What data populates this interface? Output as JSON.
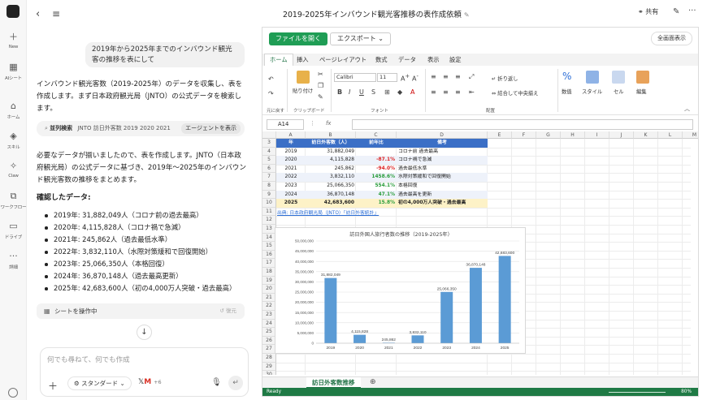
{
  "rail": {
    "items": [
      {
        "icon": "plus-icon",
        "label": "New"
      },
      {
        "icon": "grid-icon",
        "label": "AIシート"
      },
      {
        "icon": "home-icon",
        "label": "ホーム"
      },
      {
        "icon": "skill-icon",
        "label": "スキル"
      },
      {
        "icon": "claw-icon",
        "label": "Claw"
      },
      {
        "icon": "workflow-icon",
        "label": "ワークフロー"
      },
      {
        "icon": "folder-icon",
        "label": "ドライブ"
      },
      {
        "icon": "more-icon",
        "label": "詳細"
      }
    ]
  },
  "chat": {
    "user_message": "2019年から2025年までのインバウンド観光客の推移を表にして",
    "reply1": "インバウンド観光客数（2019-2025年）のデータを収集し、表を作成します。まず日本政府観光局（JNTO）の公式データを検索します。",
    "search": {
      "label": "並列検索",
      "query": "JNTO 訪日外客数 2019 2020 2021",
      "agent_button": "エージェントを表示"
    },
    "reply2": "必要なデータが揃いましたので、表を作成します。JNTO（日本政府観光局）の公式データに基づき、2019年〜2025年のインバウンド観光客数の推移をまとめます。",
    "confirmed_heading": "確認したデータ:",
    "bullets": [
      "2019年: 31,882,049人（コロナ前の過去最高）",
      "2020年: 4,115,828人（コロナ禍で急減）",
      "2021年: 245,862人（過去最低水準）",
      "2022年: 3,832,110人（水際対策緩和で回復開始）",
      "2023年: 25,066,350人（本格回復）",
      "2024年: 36,870,148人（過去最高更新）",
      "2025年: 42,683,600人（初の4,000万人突破・過去最高）"
    ],
    "operate_sheet": "シートを操作中",
    "restore": "復元",
    "input_placeholder": "何でも尋ねて、何でも作成",
    "mode": "スタンダード",
    "tools_more": "+6"
  },
  "topbar": {
    "title": "2019-2025年インバウンド観光客推移の表作成依頼",
    "share": "共有"
  },
  "excel": {
    "open_button": "ファイルを開く",
    "export_button": "エクスポート",
    "fullscreen_button": "全画面表示",
    "tabs": [
      "ホーム",
      "挿入",
      "ページレイアウト",
      "数式",
      "データ",
      "表示",
      "設定"
    ],
    "font_name": "Calibri",
    "font_size": "11",
    "group_labels": {
      "undo": "元に戻す",
      "clipboard": "クリップボード",
      "font": "フォント",
      "align": "配置"
    },
    "ribbon": {
      "paste": "貼り付け",
      "wrap": "折り返し",
      "merge": "結合して中央揃え",
      "number": "数值",
      "style": "スタイル",
      "cell": "セル",
      "edit": "編集"
    },
    "cell_ref": "A14",
    "fx": "fx",
    "columns": [
      "A",
      "B",
      "C",
      "D",
      "E",
      "F",
      "G",
      "H",
      "I",
      "J",
      "K",
      "L",
      "M"
    ],
    "rows": [
      "3",
      "4",
      "5",
      "6",
      "7",
      "8",
      "9",
      "10",
      "11",
      "12",
      "13",
      "14",
      "15",
      "16",
      "17",
      "18",
      "19",
      "20",
      "21",
      "22",
      "23",
      "24",
      "25",
      "26",
      "27",
      "28",
      "29",
      "30",
      "31"
    ],
    "table": {
      "headers": [
        "年",
        "訪日外客数（人）",
        "前年比",
        "備考"
      ],
      "rows": [
        [
          "2019",
          "31,882,049",
          "",
          "コロナ前 過去最高"
        ],
        [
          "2020",
          "4,115,828",
          "-87.1%",
          "コロナ禍で急減"
        ],
        [
          "2021",
          "245,862",
          "-94.0%",
          "過去最低水準"
        ],
        [
          "2022",
          "3,832,110",
          "1458.6%",
          "水際対策緩和で回復開始"
        ],
        [
          "2023",
          "25,066,350",
          "554.1%",
          "本格回復"
        ],
        [
          "2024",
          "36,870,148",
          "47.1%",
          "過去最高を更新"
        ],
        [
          "2025",
          "42,683,600",
          "15.8%",
          "初の4,000万人突破・過去最高"
        ]
      ]
    },
    "source_note": "出典: 日本政府観光局（JNTO）「訪日外客統計」",
    "sheet_tab": "訪日外客数推移",
    "status": "Ready",
    "zoom": "80%"
  },
  "chart_data": {
    "type": "bar",
    "title": "訪日外国人旅行者数の推移（2019-2025年）",
    "categories": [
      "2019",
      "2020",
      "2021",
      "2022",
      "2023",
      "2024",
      "2025"
    ],
    "values": [
      31882049,
      4115828,
      245862,
      3832110,
      25066350,
      36870148,
      42683600
    ],
    "data_labels": [
      "31,882,049",
      "4,115,828",
      "245,862",
      "3,832,110",
      "25,066,350",
      "36,870,148",
      "42,683,600"
    ],
    "ylim": [
      0,
      50000000
    ],
    "yticks": [
      "0",
      "5,000,000",
      "10,000,000",
      "15,000,000",
      "20,000,000",
      "25,000,000",
      "30,000,000",
      "35,000,000",
      "40,000,000",
      "45,000,000",
      "50,000,000"
    ],
    "bar_color": "#5b9bd5",
    "grid": true
  }
}
